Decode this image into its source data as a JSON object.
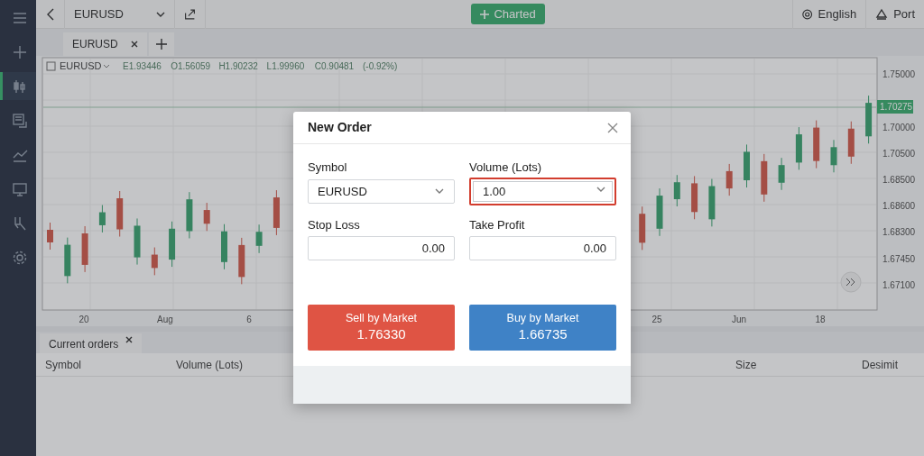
{
  "sidebar": {
    "items": [
      {
        "kind": "menu",
        "selected": false
      },
      {
        "kind": "plus",
        "selected": false
      },
      {
        "kind": "candles",
        "selected": true
      },
      {
        "kind": "news",
        "selected": false
      },
      {
        "kind": "trend",
        "selected": false
      },
      {
        "kind": "monitor",
        "selected": false
      },
      {
        "kind": "tools",
        "selected": false
      },
      {
        "kind": "settings",
        "selected": false
      }
    ]
  },
  "toolbar": {
    "symbol": "EURUSD",
    "action_button": "Charted",
    "language": "English",
    "account": "Port"
  },
  "chart_tabs": [
    {
      "label": "EURUSD",
      "selected": true
    }
  ],
  "chart": {
    "symbol": "EURUSD",
    "legend": [
      "E1.93446",
      "O1.56059",
      "H1.90232",
      "L1.99960",
      "C0.90481",
      "(-0.92%)"
    ],
    "price_labels": [
      "1.75000",
      "1.70000",
      "1.70500",
      "1.68500",
      "1.68600",
      "1.68300",
      "1.67450",
      "1.67100"
    ],
    "current_price": "1.70275",
    "time_labels": [
      "20",
      "Aug",
      "6",
      "25",
      "Jun",
      "18"
    ]
  },
  "orders_panel": {
    "tab": "Current orders",
    "columns": [
      "Symbol",
      "Volume (Lots)",
      "Size",
      "Desimit"
    ]
  },
  "dialog": {
    "title": "New Order",
    "fields": [
      {
        "label": "Symbol",
        "kind": "select",
        "value": "EURUSD",
        "focused": false
      },
      {
        "label": "Volume (Lots)",
        "kind": "select",
        "value": "1.00",
        "focused": true
      },
      {
        "label": "Stop Loss",
        "kind": "number",
        "value": "0.00",
        "focused": false
      },
      {
        "label": "Take Profit",
        "kind": "number",
        "value": "0.00",
        "focused": false
      }
    ],
    "sell": {
      "label": "Sell by Market",
      "price": "1.76330"
    },
    "buy": {
      "label": "Buy by Market",
      "price": "1.66735"
    }
  }
}
